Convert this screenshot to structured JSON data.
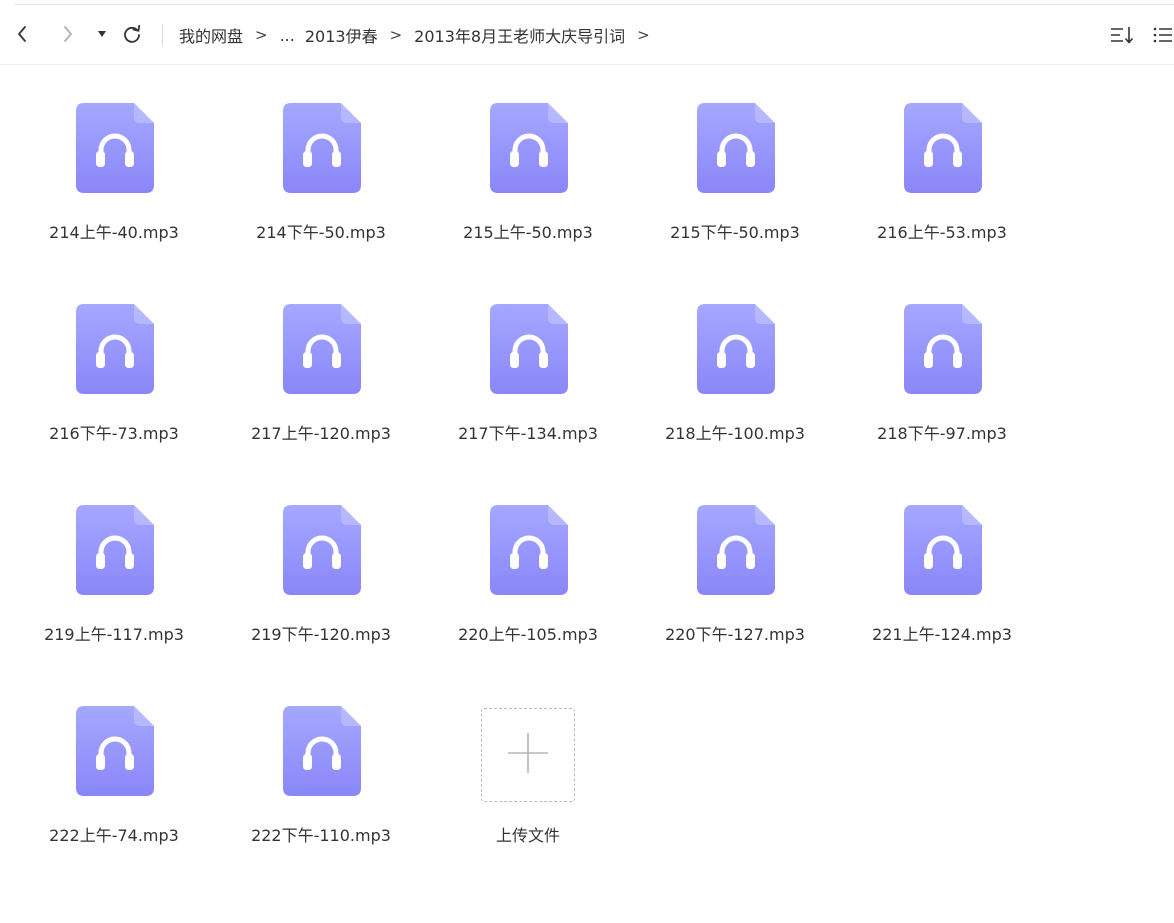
{
  "toolbar": {
    "back_icon": "chevron-left-icon",
    "forward_icon": "chevron-right-icon",
    "history_icon": "caret-down-icon",
    "refresh_icon": "refresh-icon",
    "breadcrumb": {
      "root": "我的网盘",
      "ellipsis": "...",
      "level1": "2013伊春",
      "level2": "2013年8月王老师大庆导引词",
      "separator": ">"
    },
    "sort_icon": "sort-icon",
    "view_icon": "list-view-icon"
  },
  "file_icon_color_top": "#a5a8ff",
  "file_icon_color_bottom": "#8a86f8",
  "files": [
    {
      "name": "214上午-40.mp3",
      "icon": "audio-file-icon"
    },
    {
      "name": "214下午-50.mp3",
      "icon": "audio-file-icon"
    },
    {
      "name": "215上午-50.mp3",
      "icon": "audio-file-icon"
    },
    {
      "name": "215下午-50.mp3",
      "icon": "audio-file-icon"
    },
    {
      "name": "216上午-53.mp3",
      "icon": "audio-file-icon"
    },
    {
      "name": "216下午-73.mp3",
      "icon": "audio-file-icon"
    },
    {
      "name": "217上午-120.mp3",
      "icon": "audio-file-icon"
    },
    {
      "name": "217下午-134.mp3",
      "icon": "audio-file-icon"
    },
    {
      "name": "218上午-100.mp3",
      "icon": "audio-file-icon"
    },
    {
      "name": "218下午-97.mp3",
      "icon": "audio-file-icon"
    },
    {
      "name": "219上午-117.mp3",
      "icon": "audio-file-icon"
    },
    {
      "name": "219下午-120.mp3",
      "icon": "audio-file-icon"
    },
    {
      "name": "220上午-105.mp3",
      "icon": "audio-file-icon"
    },
    {
      "name": "220下午-127.mp3",
      "icon": "audio-file-icon"
    },
    {
      "name": "221上午-124.mp3",
      "icon": "audio-file-icon"
    },
    {
      "name": "222上午-74.mp3",
      "icon": "audio-file-icon"
    },
    {
      "name": "222下午-110.mp3",
      "icon": "audio-file-icon"
    }
  ],
  "upload": {
    "label": "上传文件",
    "icon": "plus-icon"
  }
}
